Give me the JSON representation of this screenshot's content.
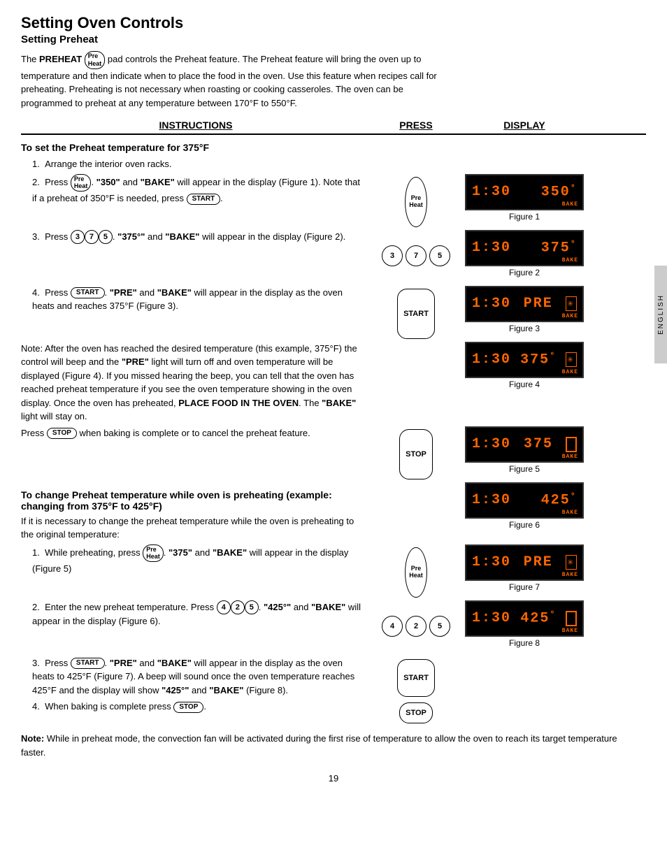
{
  "page": {
    "main_title": "Setting Oven Controls",
    "sub_title": "Setting Preheat",
    "intro": "The PREHEAT pad controls the Preheat feature. The Preheat feature will bring the oven up to temperature and then indicate when to place the food in the oven. Use this feature when recipes call for preheating. Preheating is not necessary when roasting or cooking casseroles. The oven can be programmed to preheat at any temperature between 170°F to 550°F.",
    "col_instructions": "INSTRUCTIONS",
    "col_press": "PRESS",
    "col_display": "DISPLAY",
    "section1_heading": "To set the Preheat temperature for 375°F",
    "steps1": [
      "Arrange the interior oven racks.",
      "Press  \"350\" and \"BAKE\" will appear in the display (Figure 1). Note that if a preheat of 350°F is needed, press .",
      "Press  . \"375°\" and \"BAKE\" will appear in the display (Figure 2).",
      "Press  . \"PRE\" and \"BAKE\" will appear in the display as the oven heats and reaches 375°F (Figure 3)."
    ],
    "note1": "Note: After the oven has reached the desired temperature (this example, 375°F) the control will beep and the \"PRE\" light will turn off and oven temperature will be displayed (Figure 4). If you missed hearing the beep, you can tell that the oven has reached preheat temperature if you see the oven temperature showing in the oven display. Once the oven has preheated, PLACE FOOD IN THE OVEN. The \"BAKE\" light will stay on.",
    "press_stop1": "Press  when baking is complete or to cancel the preheat feature.",
    "section2_heading": "To change Preheat temperature while oven is preheating (example: changing from 375°F to 425°F)",
    "section2_intro": "If it is necessary to change the preheat temperature while the oven is preheating to the original temperature:",
    "steps2": [
      "While preheating, press  . \"375\" and \"BAKE\" will appear in the display (Figure 5)",
      "Enter the new preheat temperature. Press  . \"425°\" and \"BAKE\" will appear in the display (Figure 6).",
      "Press  . \"PRE\" and \"BAKE\" will appear in the display as the oven heats to 425°F (Figure 7). A beep will sound once the oven temperature reaches 425°F and the display will show \"425°\" and \"BAKE\" (Figure 8).",
      "When baking is complete press ."
    ],
    "note2": "Note: While in preheat mode, the convection fan will be activated during the first rise of temperature to allow the oven to reach its target temperature faster.",
    "figures": [
      {
        "id": "fig1",
        "label": "Figure 1",
        "line1": "1:30",
        "line2": "350",
        "dot": "°",
        "extra": "",
        "bake": true
      },
      {
        "id": "fig2",
        "label": "Figure 2",
        "line1": "1:30",
        "line2": "375",
        "dot": "°",
        "extra": "",
        "bake": true
      },
      {
        "id": "fig3",
        "label": "Figure 3",
        "line1": "1:30",
        "line2": "PRE",
        "dot": "",
        "extra": "snowflake",
        "bake": true
      },
      {
        "id": "fig4",
        "label": "Figure 4",
        "line1": "1:30",
        "line2": "375",
        "dot": "°",
        "extra": "snowflake",
        "bake": true
      },
      {
        "id": "fig5",
        "label": "Figure 5",
        "line1": "1:30",
        "line2": "375",
        "dot": "",
        "extra": "cursor",
        "bake": true
      },
      {
        "id": "fig6",
        "label": "Figure 6",
        "line1": "1:30",
        "line2": "425",
        "dot": "°",
        "extra": "",
        "bake": true
      },
      {
        "id": "fig7",
        "label": "Figure 7",
        "line1": "1:30",
        "line2": "PRE",
        "dot": "",
        "extra": "snowflake",
        "bake": true
      },
      {
        "id": "fig8",
        "label": "Figure 8",
        "line1": "1:30",
        "line2": "425",
        "dot": "°",
        "extra": "cursor",
        "bake": true
      }
    ],
    "page_number": "19",
    "side_tab": "ENGLISH"
  }
}
